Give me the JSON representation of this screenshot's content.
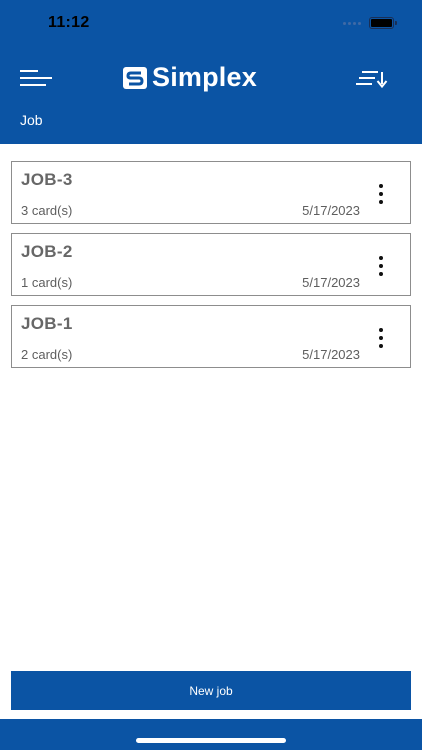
{
  "status_bar": {
    "time": "11:12"
  },
  "header": {
    "brand": "Simplex",
    "section_title": "Job",
    "icons": {
      "menu": "menu-lines-icon",
      "sort": "sort-descending-icon",
      "logo": "simplex-logo-icon"
    }
  },
  "jobs": [
    {
      "name": "JOB-3",
      "cards": "3 card(s)",
      "date": "5/17/2023"
    },
    {
      "name": "JOB-2",
      "cards": "1 card(s)",
      "date": "5/17/2023"
    },
    {
      "name": "JOB-1",
      "cards": "2 card(s)",
      "date": "5/17/2023"
    }
  ],
  "footer": {
    "new_job_label": "New job"
  },
  "colors": {
    "brand_blue": "#0b54a4",
    "card_border": "#8d8d8d",
    "card_title": "#676767"
  }
}
